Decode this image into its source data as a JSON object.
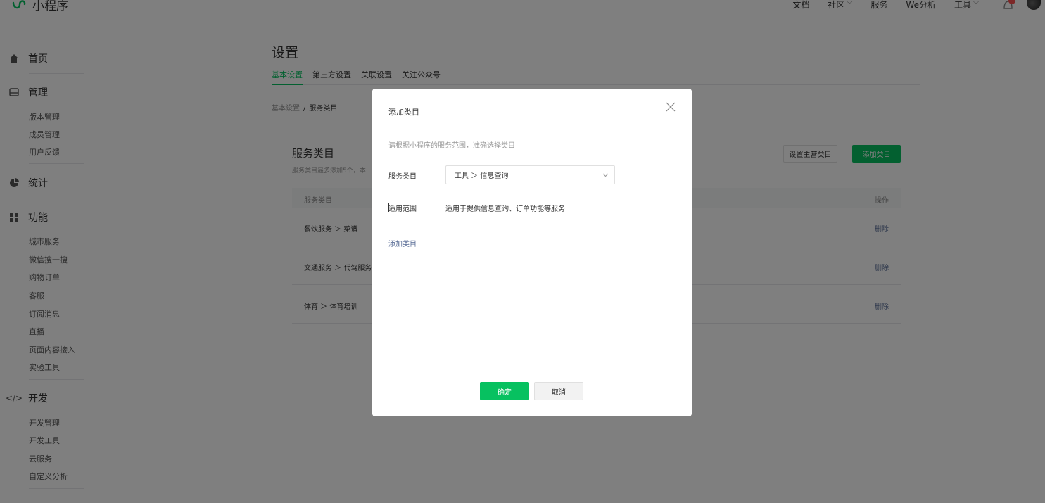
{
  "brand": {
    "name": "小程序",
    "color": "#07c160",
    "logo_icon": "miniprogram-logo-icon"
  },
  "topnav": {
    "items": [
      {
        "label": "文档",
        "caret": false
      },
      {
        "label": "社区",
        "caret": true
      },
      {
        "label": "服务",
        "caret": false
      },
      {
        "label": "We分析",
        "caret": false
      },
      {
        "label": "工具",
        "caret": true
      }
    ],
    "bell_icon": "bell-icon",
    "avatar_icon": "avatar-icon"
  },
  "sidebar": {
    "home": {
      "label": "首页",
      "icon": "home-icon"
    },
    "manage": {
      "label": "管理",
      "icon": "manage-icon",
      "items": [
        "版本管理",
        "成员管理",
        "用户反馈"
      ]
    },
    "stats": {
      "label": "统计",
      "icon": "pie-chart-icon"
    },
    "features": {
      "label": "功能",
      "icon": "grid-icon",
      "items": [
        "城市服务",
        "微信搜一搜",
        "购物订单",
        "客服",
        "订阅消息",
        "直播",
        "页面内容接入",
        "实验工具"
      ]
    },
    "dev": {
      "label": "开发",
      "icon": "code-icon",
      "items": [
        "开发管理",
        "开发工具",
        "云服务",
        "自定义分析"
      ]
    }
  },
  "main": {
    "title": "设置",
    "tabs": [
      "基本设置",
      "第三方设置",
      "关联设置",
      "关注公众号"
    ],
    "breadcrumb": {
      "parent": "基本设置",
      "separator": "/",
      "current": "服务类目"
    },
    "panel": {
      "title": "服务类目",
      "desc": "服务类目最多添加5个，本",
      "set_main_button": "设置主营类目",
      "add_button": "添加类目",
      "header_col1": "服务类目",
      "header_col2": "操作",
      "rows": [
        {
          "name": "餐饮服务 ＞ 菜谱",
          "action": "删除"
        },
        {
          "name": "交通服务 ＞ 代驾服务",
          "action": "删除"
        },
        {
          "name": "体育 ＞ 体育培训",
          "action": "删除"
        }
      ]
    }
  },
  "modal": {
    "title": "添加类目",
    "hint": "请根据小程序的服务范围，准确选择类目",
    "category_label": "服务类目",
    "category_value": "工具 ＞ 信息查询",
    "scope_label": "适用范围",
    "scope_value": "适用于提供信息查询、订单功能等服务",
    "add_link": "添加类目",
    "ok_button": "确定",
    "cancel_button": "取消"
  },
  "colors": {
    "accent": "#07c160",
    "link": "#576b95",
    "overlay": "rgba(0,0,0,0.5)"
  }
}
